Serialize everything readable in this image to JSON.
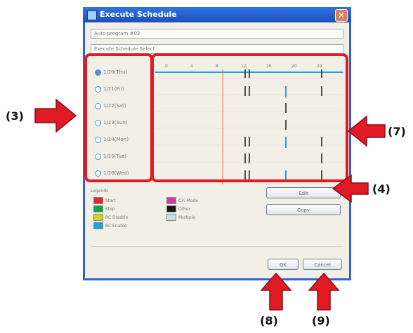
{
  "window": {
    "title": "Execute Schedule",
    "close_label": "✕"
  },
  "fields": {
    "program": "Auto program #02",
    "selection": "Execute Schedule Select"
  },
  "days": [
    {
      "label": "1/20(Thu)",
      "selected": true
    },
    {
      "label": "1/21(Fri)",
      "selected": false
    },
    {
      "label": "1/22(Sat)",
      "selected": false
    },
    {
      "label": "1/23(Sun)",
      "selected": false
    },
    {
      "label": "1/24(Mon)",
      "selected": false
    },
    {
      "label": "1/25(Tue)",
      "selected": false
    },
    {
      "label": "1/26(Wed)",
      "selected": false
    }
  ],
  "timeline": {
    "hour_labels": [
      "0",
      "4",
      "8",
      "12",
      "16",
      "20",
      "24"
    ]
  },
  "legend": {
    "title": "Legends",
    "items": [
      {
        "label": "Start",
        "color": "#e1262d"
      },
      {
        "label": "Stop",
        "color": "#1aa04a"
      },
      {
        "label": "RC Disable",
        "color": "#d8d12a"
      },
      {
        "label": "RC Enable",
        "color": "#1ca6dd"
      },
      {
        "label": "Cir. Mode",
        "color": "#d43aa4"
      },
      {
        "label": "Other",
        "color": "#1a1a1a"
      },
      {
        "label": "Multiple",
        "color": "#bfe3f0"
      }
    ]
  },
  "buttons": {
    "edit": "Edit",
    "copy": "Copy",
    "ok": "OK",
    "cancel": "Cancel"
  },
  "callouts": {
    "c3": "(3)",
    "c7": "(7)",
    "c4": "(4)",
    "c8": "(8)",
    "c9": "(9)"
  },
  "colors": {
    "title_bar": "#2a67d8",
    "highlight": "#e01b24",
    "timeline": "#1ca6dd"
  }
}
